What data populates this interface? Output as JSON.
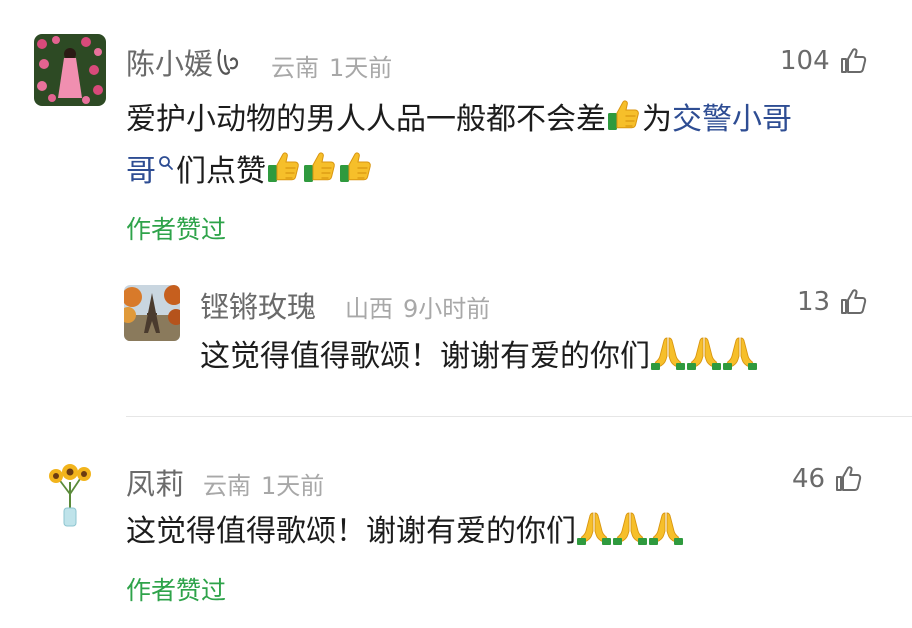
{
  "comments": [
    {
      "user": "陈小媛",
      "location": "云南",
      "time": "1天前",
      "likes": "104",
      "text_line1_before": "爱护小动物的男人人品一般都不会差",
      "text_line1_after": "为",
      "link_part1": "交警小哥",
      "link_part2": "哥",
      "text_line2_after": "们点赞",
      "author_liked": "作者赞过"
    },
    {
      "user": "铿锵玫瑰",
      "location": "山西",
      "time": "9小时前",
      "likes": "13",
      "text": "这觉得值得歌颂！谢谢有爱的你们"
    },
    {
      "user": "凤莉",
      "location": "云南",
      "time": "1天前",
      "likes": "46",
      "text": "这觉得值得歌颂！谢谢有爱的你们",
      "author_liked": "作者赞过"
    }
  ],
  "icons": {
    "like": "thumbs-up-outline-icon",
    "emoji_thumb": "thumbs-up-emoji",
    "emoji_pray": "folded-hands-emoji",
    "search": "search-icon"
  },
  "colors": {
    "link": "#2e4d93",
    "author_liked": "#2ea34a"
  }
}
